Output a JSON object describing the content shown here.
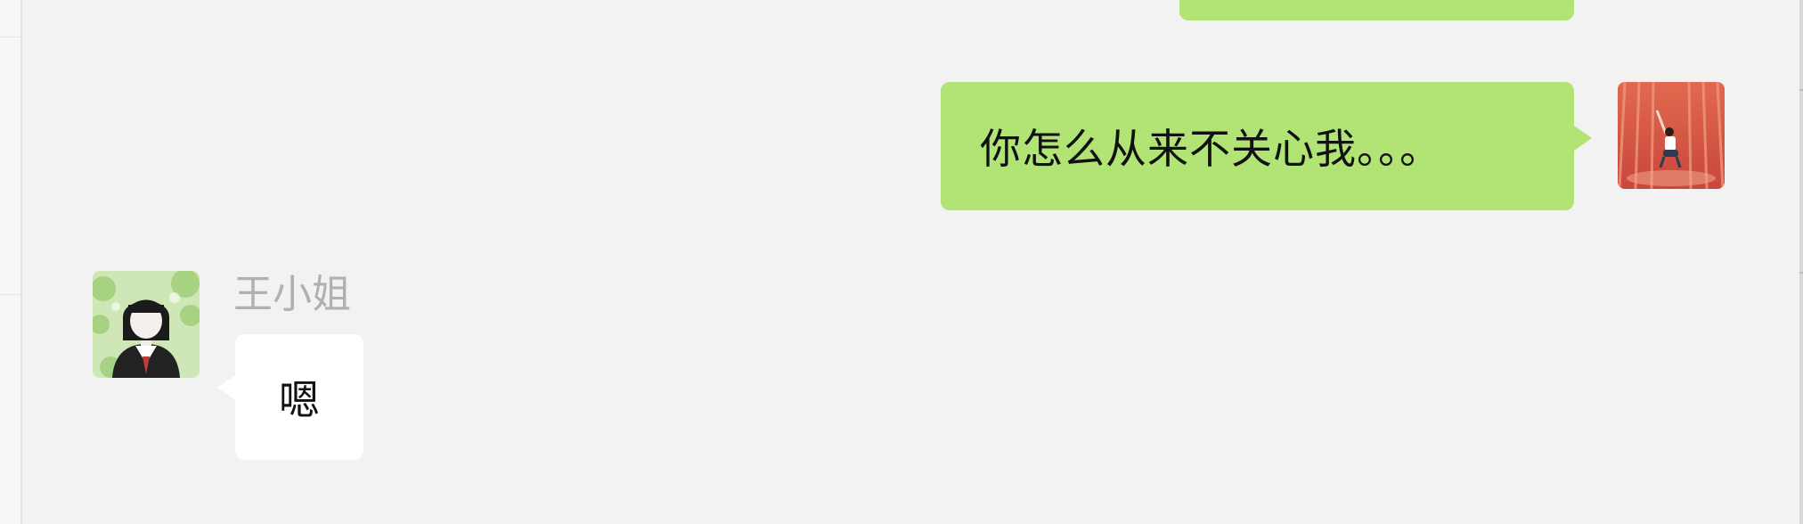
{
  "chat": {
    "messages": [
      {
        "direction": "outgoing",
        "text": ""
      },
      {
        "direction": "outgoing",
        "text": "你怎么从来不关心我。。。"
      },
      {
        "direction": "incoming",
        "sender": "王小姐",
        "text": "嗯"
      }
    ]
  },
  "colors": {
    "background": "#f2f2f2",
    "outgoing_bubble": "#b1e474",
    "incoming_bubble": "#ffffff",
    "sender_name": "#b0b0b0"
  },
  "icons": {
    "my_avatar": "user-avatar-photo-icon",
    "contact_avatar": "contact-avatar-illustration-icon"
  }
}
